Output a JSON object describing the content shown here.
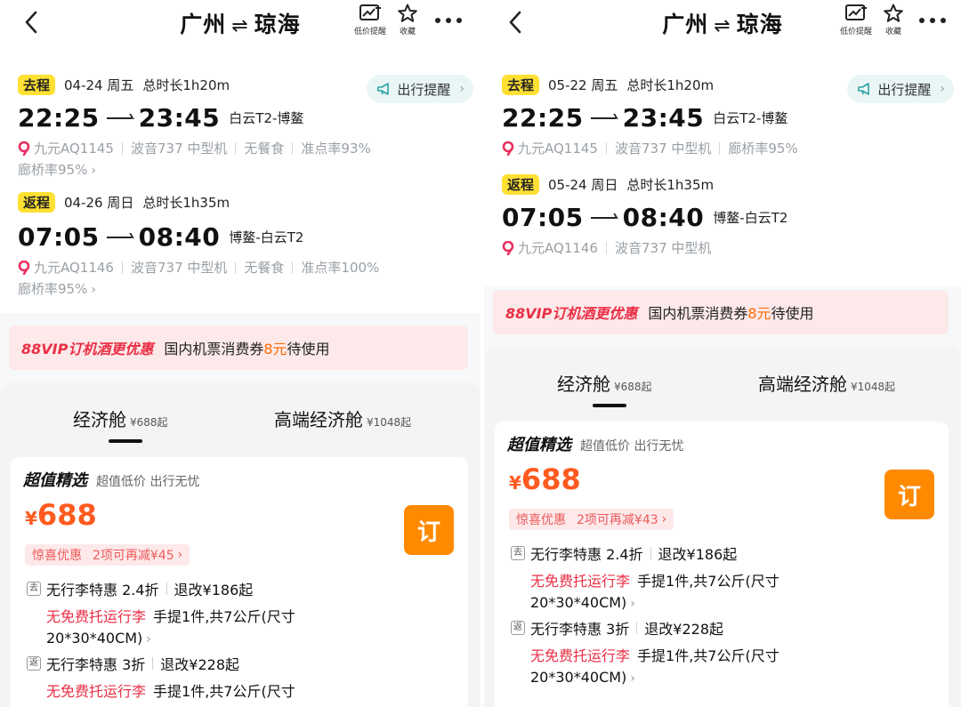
{
  "header": {
    "origin": "广州",
    "arrow": "⇌",
    "destination": "琼海",
    "price_alert_label": "低价提醒",
    "favorite_label": "收藏",
    "more_label": "•••"
  },
  "travel_reminder": "出行提醒",
  "chevron": "›",
  "screens": [
    {
      "outbound": {
        "tag": "去程",
        "date": "04-24 周五",
        "duration": "总时长1h20m",
        "dep_time": "22:25",
        "arr_time": "23:45",
        "airports": "白云T2-博鳌",
        "flight": "九元AQ1145",
        "aircraft": "波音737 中型机",
        "meal": "无餐食",
        "ontime": "准点率93%",
        "bridge": "廊桥率95%"
      },
      "return": {
        "tag": "返程",
        "date": "04-26 周日",
        "duration": "总时长1h35m",
        "dep_time": "07:05",
        "arr_time": "08:40",
        "airports": "博鳌-白云T2",
        "flight": "九元AQ1146",
        "aircraft": "波音737 中型机",
        "meal": "无餐食",
        "ontime": "准点率100%",
        "bridge": "廊桥率95%"
      }
    },
    {
      "outbound": {
        "tag": "去程",
        "date": "05-22 周五",
        "duration": "总时长1h20m",
        "dep_time": "22:25",
        "arr_time": "23:45",
        "airports": "白云T2-博鳌",
        "flight": "九元AQ1145",
        "aircraft": "波音737 中型机",
        "bridge": "廊桥率95%"
      },
      "return": {
        "tag": "返程",
        "date": "05-24 周日",
        "duration": "总时长1h35m",
        "dep_time": "07:05",
        "arr_time": "08:40",
        "airports": "博鳌-白云T2",
        "flight": "九元AQ1146",
        "aircraft": "波音737 中型机"
      }
    }
  ],
  "promo": {
    "vip": "88VIP订机酒更优惠",
    "text_before": "国内机票消费券",
    "amount": "8元",
    "text_after": "待使用"
  },
  "tabs": {
    "economy": "经济舱",
    "economy_price": "¥688起",
    "premium": "高端经济舱",
    "premium_price": "¥1048起"
  },
  "card": {
    "title": "超值精选",
    "subtitle": "超值低价 出行无忧",
    "currency": "¥",
    "price": "688",
    "book": "订",
    "disc_label": "惊喜优惠",
    "disc_left": "2项可再减¥45",
    "disc_right": "2项可再减¥43",
    "fare1_dir": "去",
    "fare1_name": "无行李特惠 2.4折",
    "fare1_change": "退改¥186起",
    "fare2_dir": "返",
    "fare2_name": "无行李特惠 3折",
    "fare2_change": "退改¥228起",
    "no_bag": "无免费托运行李",
    "carry": "手提1件,共7公斤(尺寸",
    "carry_size": "20*30*40CM)"
  }
}
